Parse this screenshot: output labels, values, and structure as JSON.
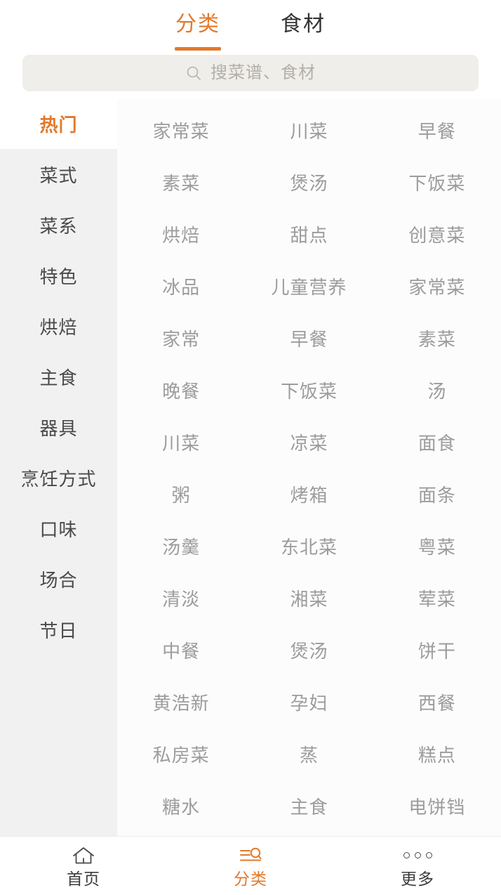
{
  "header": {
    "tabs": [
      {
        "label": "分类",
        "active": true
      },
      {
        "label": "食材",
        "active": false
      }
    ],
    "accent_color": "#E2792B"
  },
  "search": {
    "icon": "search-icon",
    "placeholder": "搜菜谱、食材",
    "value": ""
  },
  "sidebar": {
    "items": [
      {
        "label": "热门",
        "active": true
      },
      {
        "label": "菜式",
        "active": false
      },
      {
        "label": "菜系",
        "active": false
      },
      {
        "label": "特色",
        "active": false
      },
      {
        "label": "烘焙",
        "active": false
      },
      {
        "label": "主食",
        "active": false
      },
      {
        "label": "器具",
        "active": false
      },
      {
        "label": "烹饪方式",
        "active": false
      },
      {
        "label": "口味",
        "active": false
      },
      {
        "label": "场合",
        "active": false
      },
      {
        "label": "节日",
        "active": false
      }
    ]
  },
  "grid": {
    "columns": 3,
    "items": [
      "家常菜",
      "川菜",
      "早餐",
      "素菜",
      "煲汤",
      "下饭菜",
      "烘焙",
      "甜点",
      "创意菜",
      "冰品",
      "儿童营养",
      "家常菜",
      "家常",
      "早餐",
      "素菜",
      "晚餐",
      "下饭菜",
      "汤",
      "川菜",
      "凉菜",
      "面食",
      "粥",
      "烤箱",
      "面条",
      "汤羹",
      "东北菜",
      "粤菜",
      "清淡",
      "湘菜",
      "荤菜",
      "中餐",
      "煲汤",
      "饼干",
      "黄浩新",
      "孕妇",
      "西餐",
      "私房菜",
      "蒸",
      "糕点",
      "糖水",
      "主食",
      "电饼铛"
    ]
  },
  "bottom_nav": {
    "items": [
      {
        "label": "首页",
        "icon": "home-icon",
        "active": false
      },
      {
        "label": "分类",
        "icon": "category-search-icon",
        "active": true
      },
      {
        "label": "更多",
        "icon": "more-dots-icon",
        "active": false
      }
    ]
  },
  "colors": {
    "accent": "#E2792B",
    "sidebar_bg": "#F1F1F1",
    "search_bg": "#EFEEEA",
    "grid_text": "#9C9C9C"
  }
}
